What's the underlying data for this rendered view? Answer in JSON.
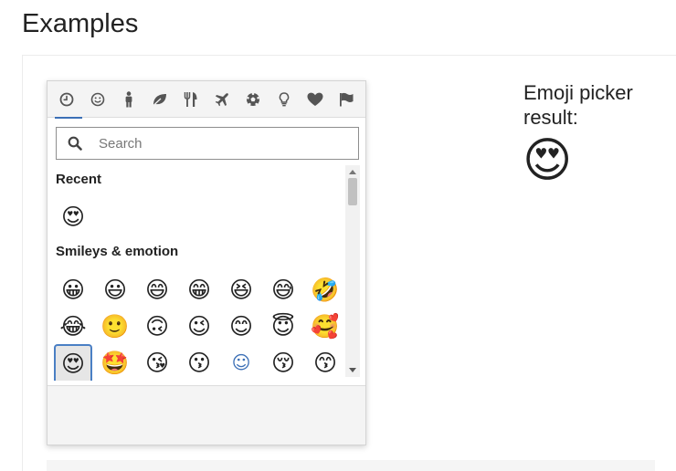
{
  "page": {
    "heading": "Examples"
  },
  "picker": {
    "categories": [
      {
        "id": "recent",
        "icon": "clock-icon",
        "active": true
      },
      {
        "id": "smileys",
        "icon": "smiley-icon"
      },
      {
        "id": "people",
        "icon": "person-icon"
      },
      {
        "id": "nature",
        "icon": "leaf-icon"
      },
      {
        "id": "food",
        "icon": "fork-knife-icon"
      },
      {
        "id": "travel",
        "icon": "airplane-icon"
      },
      {
        "id": "activities",
        "icon": "soccer-ball-icon"
      },
      {
        "id": "objects",
        "icon": "lightbulb-icon"
      },
      {
        "id": "symbols",
        "icon": "heart-icon"
      },
      {
        "id": "flags",
        "icon": "flag-icon"
      }
    ],
    "search": {
      "placeholder": "Search"
    },
    "sections": {
      "recent": {
        "title": "Recent",
        "emojis": [
          "😍"
        ]
      },
      "smileys": {
        "title": "Smileys & emotion",
        "rows": [
          [
            "😀",
            "😃",
            "😄",
            "😁",
            "😆",
            "😅",
            "🤣"
          ],
          [
            "😂",
            "🙂",
            "🙃",
            "😉",
            "😊",
            "😇",
            "🥰"
          ],
          [
            "😍",
            "🤩",
            "😘",
            "😗",
            "☺",
            "😚",
            "😙"
          ]
        ],
        "selected": [
          2,
          0
        ]
      }
    }
  },
  "result": {
    "label": "Emoji picker result:",
    "emoji": "😍"
  },
  "colors": {
    "accent": "#3b6fb6",
    "icon": "#555555"
  }
}
